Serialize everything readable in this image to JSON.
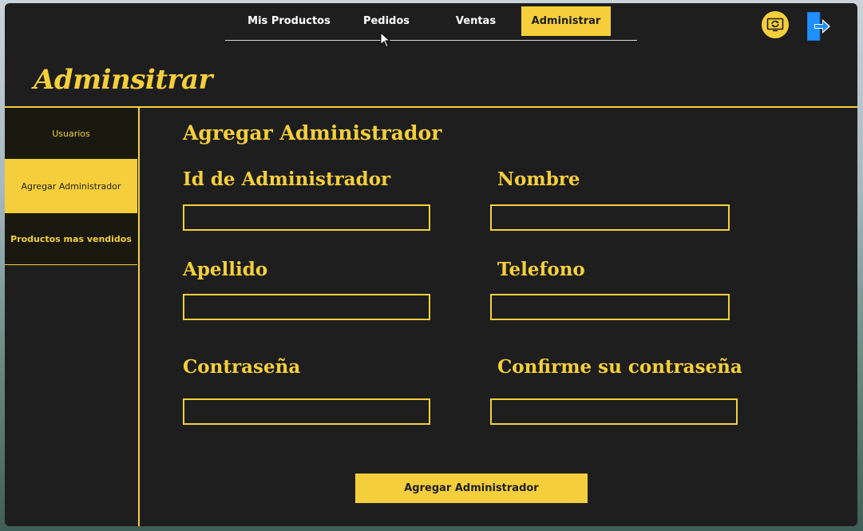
{
  "nav": {
    "tabs": [
      {
        "label": "Mis Productos"
      },
      {
        "label": "Pedidos"
      },
      {
        "label": "Ventas"
      },
      {
        "label": "Administrar",
        "active": true
      }
    ]
  },
  "header": {
    "title": "Adminsitrar"
  },
  "sidebar": {
    "items": [
      {
        "label": "Usuarios"
      },
      {
        "label": "Agregar Administrador",
        "active": true
      },
      {
        "label": "Productos mas vendidos"
      }
    ]
  },
  "form": {
    "title": "Agregar Administrador",
    "fields": {
      "id": {
        "label": "Id de Administrador",
        "value": ""
      },
      "nombre": {
        "label": "Nombre",
        "value": ""
      },
      "apellido": {
        "label": "Apellido",
        "value": ""
      },
      "telefono": {
        "label": "Telefono",
        "value": ""
      },
      "contrasena": {
        "label": "Contraseña",
        "value": ""
      },
      "confirmar": {
        "label": "Confirme su contraseña",
        "value": ""
      }
    },
    "submit_label": "Agregar Administrador"
  },
  "colors": {
    "accent": "#f5cf3b",
    "background": "#1e1e1e",
    "sidebar_bg": "#19190f",
    "logout_blue": "#1e90ff"
  },
  "icons": {
    "refresh": "refresh-icon",
    "logout": "logout-icon"
  }
}
